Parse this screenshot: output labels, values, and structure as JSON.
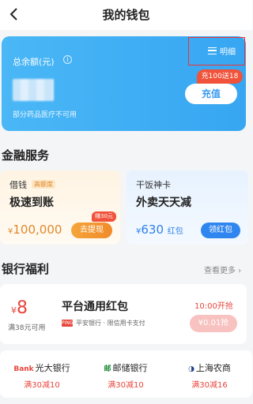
{
  "header": {
    "title": "我的钱包",
    "back_icon": "back-arrow-icon"
  },
  "wallet": {
    "balance_label": "总余额(元)",
    "info_icon": "i",
    "detail_label": "明细",
    "promo_badge": "充100送18",
    "recharge_label": "充值",
    "note": "部分药品医疗不可用"
  },
  "finance": {
    "title": "金融服务",
    "loan": {
      "name": "借钱",
      "tag": "高额度",
      "headline": "极速到账",
      "amount_prefix": "¥",
      "amount": "100,000",
      "button_label": "去提现",
      "badge": "赚30元"
    },
    "meal": {
      "name": "干饭神卡",
      "headline": "外卖天天减",
      "amount_prefix": "¥",
      "amount": "630",
      "unit": "红包",
      "button_label": "领红包"
    }
  },
  "bank_benefits": {
    "title": "银行福利",
    "more_label": "查看更多 ›",
    "coupon": {
      "yen": "¥",
      "amount": "8",
      "condition": "满38元可用",
      "title": "平台通用红包",
      "bank_logo_text": "PINGAN",
      "subtitle": "平安银行 · 限信用卡支付",
      "time": "10:00开抢",
      "button_label": "¥0.01抢"
    },
    "banks": [
      {
        "logo": "Bank",
        "name": "光大银行",
        "offer": "满30减10"
      },
      {
        "logo": "邮",
        "name": "邮储银行",
        "offer": "满30减10"
      },
      {
        "logo": "◑",
        "name": "上海农商",
        "offer": "满30减16"
      }
    ]
  },
  "colors": {
    "wallet_gradient_start": "#4ab7f6",
    "wallet_gradient_end": "#37a6f2",
    "accent_red": "#e8453c",
    "accent_orange": "#f08a2a",
    "accent_blue": "#2f86ef"
  }
}
